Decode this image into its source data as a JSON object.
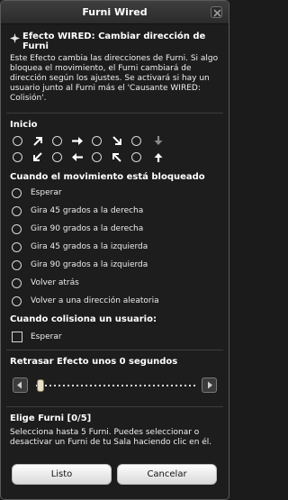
{
  "window": {
    "title": "Furni Wired"
  },
  "effect": {
    "title": "Efecto WIRED: Cambiar dirección de Furni",
    "description": "Este Efecto cambia las direcciones de Furni. Si algo bloquea el movimiento, el Furni cambiará de dirección según los ajustes. Se activará si hay un usuario junto al Furni más el 'Causante WIRED: Colisión'."
  },
  "start": {
    "title": "Inicio",
    "directions": [
      "arrow-up-right-icon",
      "arrow-right-icon",
      "arrow-down-right-icon",
      "arrow-down-icon",
      "arrow-down-left-icon",
      "arrow-left-icon",
      "arrow-up-left-icon",
      "arrow-up-icon"
    ]
  },
  "blocked": {
    "title": "Cuando el movimiento está bloqueado",
    "options": [
      "Esperar",
      "Gira 45 grados a la derecha",
      "Gira 90 grados a la derecha",
      "Gira 45 grados a la izquierda",
      "Gira 90 grados a la izquierda",
      "Volver atrás",
      "Volver a una dirección aleatoria"
    ]
  },
  "collision": {
    "title": "Cuando colisiona un usuario:",
    "checkbox_label": "Esperar"
  },
  "delay": {
    "title": "Retrasar Efecto unos 0 segundos",
    "value": 0
  },
  "furni": {
    "title": "Elige Furni [0/5]",
    "description": "Selecciona hasta 5 Furni. Puedes seleccionar o desactivar un Furni de tu Sala haciendo clic en él."
  },
  "buttons": {
    "ok": "Listo",
    "cancel": "Cancelar"
  }
}
